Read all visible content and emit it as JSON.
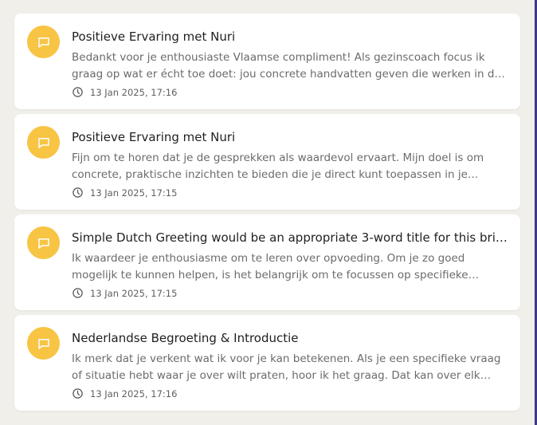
{
  "theme": {
    "background": "#f1efe9",
    "card": "#ffffff",
    "accent": "#f7c444",
    "right_border": "#3d3a86"
  },
  "conversations": [
    {
      "icon": "chat-bubble-icon",
      "title": "Positieve Ervaring met Nuri",
      "preview": "Bedankt voor je enthousiaste Vlaamse compliment! Als gezinscoach focus ik graag op wat er écht toe doet: jou concrete handvatten geven die werken in de praktijk. **Waar…",
      "timestamp": "13 Jan 2025, 17:16"
    },
    {
      "icon": "chat-bubble-icon",
      "title": "Positieve Ervaring met Nuri",
      "preview": "Fijn om te horen dat je de gesprekken als waardevol ervaart. Mijn doel is om concrete, praktische inzichten te bieden die je direct kunt toepassen in je gezinssituatie. **Ik sta…",
      "timestamp": "13 Jan 2025, 17:15"
    },
    {
      "icon": "chat-bubble-icon",
      "title": "Simple Dutch Greeting would be an appropriate 3-word title for this brief…",
      "preview": "Ik waardeer je enthousiasme om te leren over opvoeding. Om je zo goed mogelijk te kunnen helpen, is het belangrijk om te focussen op specifieke onderwerpen of…",
      "timestamp": "13 Jan 2025, 17:15"
    },
    {
      "icon": "chat-bubble-icon",
      "title": "Nederlandse Begroeting & Introductie",
      "preview": "Ik merk dat je verkent wat ik voor je kan betekenen. Als je een specifieke vraag of situatie hebt waar je over wilt praten, hoor ik het graag. Dat kan over elk aspect van…",
      "timestamp": "13 Jan 2025, 17:16"
    }
  ]
}
